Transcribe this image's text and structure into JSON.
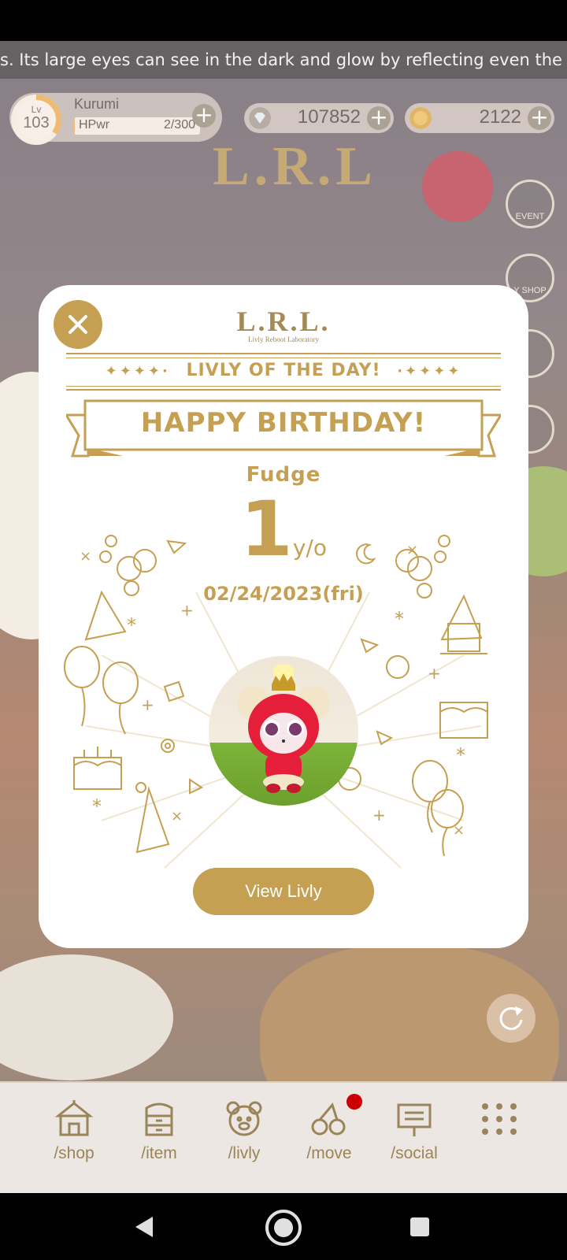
{
  "ticker": {
    "text": "s. Its large eyes can see in the dark and glow by reflecting even the"
  },
  "hud": {
    "level_label": "Lv",
    "level": "103",
    "player_name": "Kurumi",
    "hp_label": "HPwr",
    "hp_value": "2/300",
    "hp_fraction": 0.0067,
    "gems": "107852",
    "coins": "2122"
  },
  "side_buttons": {
    "event_label": "EVENT",
    "shop_label": "Y SHOP"
  },
  "modal": {
    "logo_title": "L.R.L.",
    "logo_subtitle": "Livly Reboot Laboratory",
    "day_title": "LIVLY OF THE DAY!",
    "sparkles_left": "✦✦✦✦·",
    "sparkles_right": "·✦✦✦✦",
    "headline": "HAPPY BIRTHDAY!",
    "livly_name": "Fudge",
    "age_number": "1",
    "age_unit": "y/o",
    "date": "02/24/2023(fri)",
    "view_button": "View Livly"
  },
  "bottom_nav": {
    "items": [
      {
        "label": "/shop",
        "icon": "tent-icon"
      },
      {
        "label": "/item",
        "icon": "drawer-icon"
      },
      {
        "label": "/livly",
        "icon": "bear-face-icon"
      },
      {
        "label": "/move",
        "icon": "move-icon"
      },
      {
        "label": "/social",
        "icon": "sign-board-icon"
      },
      {
        "label": "",
        "icon": "grid-menu-icon"
      }
    ]
  },
  "colors": {
    "gold": "#c5a052",
    "brown": "#9a845a",
    "accent": "#e8a33a",
    "notification": "#cc0000"
  }
}
